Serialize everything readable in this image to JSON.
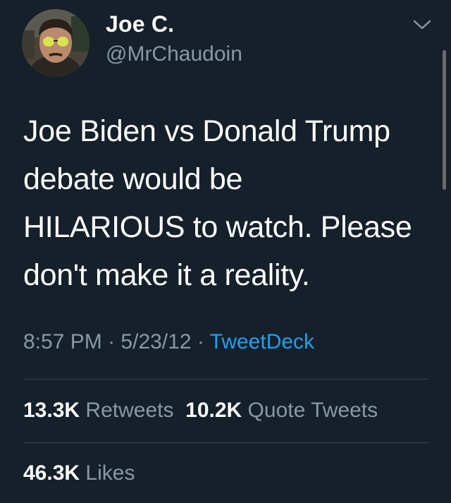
{
  "author": {
    "display_name": "Joe C.",
    "handle": "@MrChaudoin",
    "avatar_icon": "profile-photo"
  },
  "tweet": {
    "lines": [
      "Joe Biden vs Donald Trump",
      "debate would be",
      "HILARIOUS to watch. Please",
      "don't make it a reality."
    ]
  },
  "meta": {
    "time": "8:57 PM",
    "separator": "·",
    "date": "5/23/12",
    "source": "TweetDeck"
  },
  "stats": {
    "retweets_count": "13.3K",
    "retweets_label": "Retweets",
    "quotes_count": "10.2K",
    "quotes_label": "Quote Tweets",
    "likes_count": "46.3K",
    "likes_label": "Likes"
  },
  "colors": {
    "background": "#15202b",
    "text": "#ffffff",
    "muted": "#8899a6",
    "link": "#1da1f2",
    "divider": "#38444d"
  }
}
